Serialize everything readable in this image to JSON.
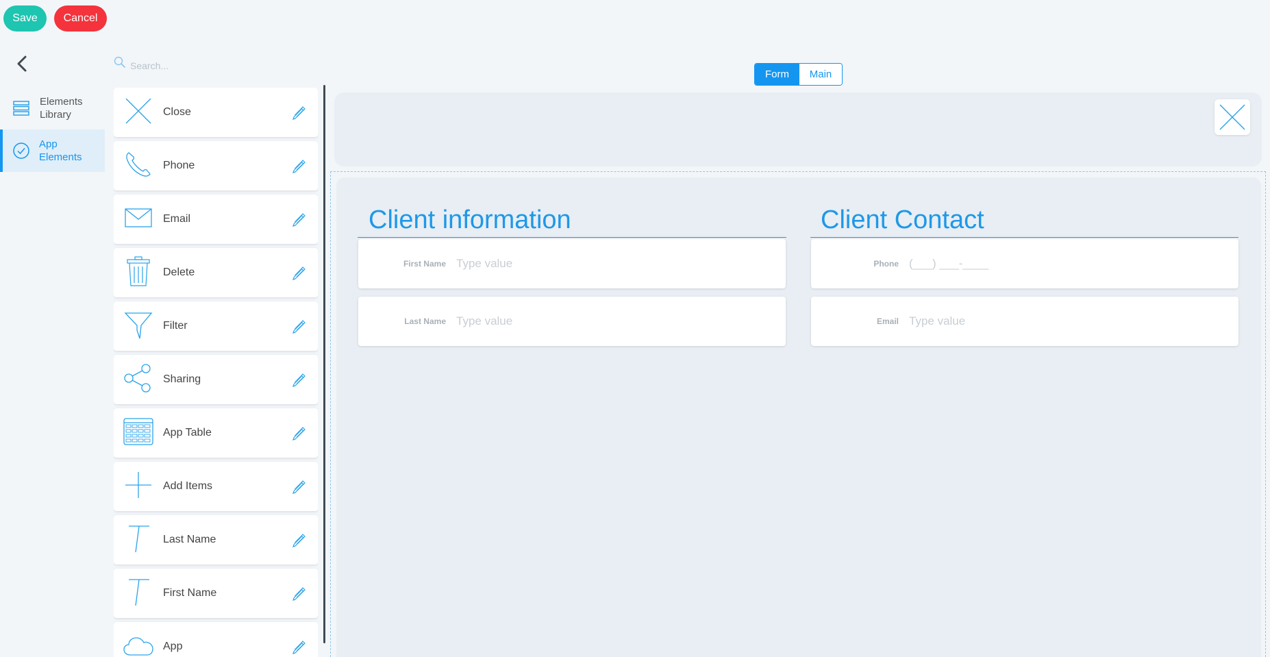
{
  "toolbar": {
    "save_label": "Save",
    "cancel_label": "Cancel"
  },
  "nav": {
    "back_icon": "chevron-left-icon",
    "items": [
      {
        "label": "Elements\nLibrary",
        "icon": "stack-icon",
        "active": false
      },
      {
        "label": "App\nElements",
        "icon": "check-circle-icon",
        "active": true
      }
    ]
  },
  "search": {
    "placeholder": "Search...",
    "value": ""
  },
  "elements": [
    {
      "label": "Close",
      "icon": "close-icon"
    },
    {
      "label": "Phone",
      "icon": "phone-icon"
    },
    {
      "label": "Email",
      "icon": "envelope-icon"
    },
    {
      "label": "Delete",
      "icon": "trash-icon"
    },
    {
      "label": "Filter",
      "icon": "funnel-icon"
    },
    {
      "label": "Sharing",
      "icon": "share-icon"
    },
    {
      "label": "App Table",
      "icon": "table-icon"
    },
    {
      "label": "Add Items",
      "icon": "plus-icon"
    },
    {
      "label": "Last Name",
      "icon": "text-icon"
    },
    {
      "label": "First Name",
      "icon": "text-icon"
    },
    {
      "label": "App",
      "icon": "cloud-icon"
    }
  ],
  "tabs": [
    {
      "label": "Form",
      "active": true
    },
    {
      "label": "Main",
      "active": false
    }
  ],
  "form": {
    "sections": [
      {
        "title": "Client information",
        "fields": [
          {
            "label": "First Name",
            "placeholder": "Type value",
            "value": ""
          },
          {
            "label": "Last Name",
            "placeholder": "Type value",
            "value": ""
          }
        ]
      },
      {
        "title": "Client Contact",
        "fields": [
          {
            "label": "Phone",
            "placeholder": "(___) ___-____",
            "value": ""
          },
          {
            "label": "Email",
            "placeholder": "Type value",
            "value": ""
          }
        ]
      }
    ]
  },
  "colors": {
    "accent": "#1496f0",
    "save": "#1ec5b0",
    "cancel": "#f4333c",
    "icon_stroke": "#29a3ea"
  }
}
